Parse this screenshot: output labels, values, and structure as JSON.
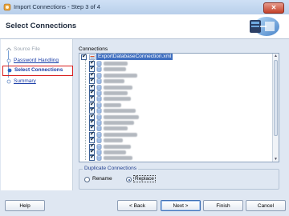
{
  "window": {
    "title": "Import Connections - Step 3 of 4",
    "close_glyph": "✕"
  },
  "header": {
    "heading": "Select Connections"
  },
  "steps": [
    {
      "label": "Source File",
      "state": "done"
    },
    {
      "label": "Password Handling",
      "state": "link"
    },
    {
      "label": "Select Connections",
      "state": "current"
    },
    {
      "label": "Summary",
      "state": "link"
    }
  ],
  "connections": {
    "label": "Connections",
    "root_label": "ExportDatabaseConnection.xml",
    "item_count": 17
  },
  "duplicate": {
    "legend": "Duplicate Connections",
    "rename_label": "Rename",
    "replace_label": "Replace",
    "selected": "replace"
  },
  "buttons": {
    "help": "Help",
    "back": "< Back",
    "next": "Next >",
    "finish": "Finish",
    "cancel": "Cancel"
  }
}
